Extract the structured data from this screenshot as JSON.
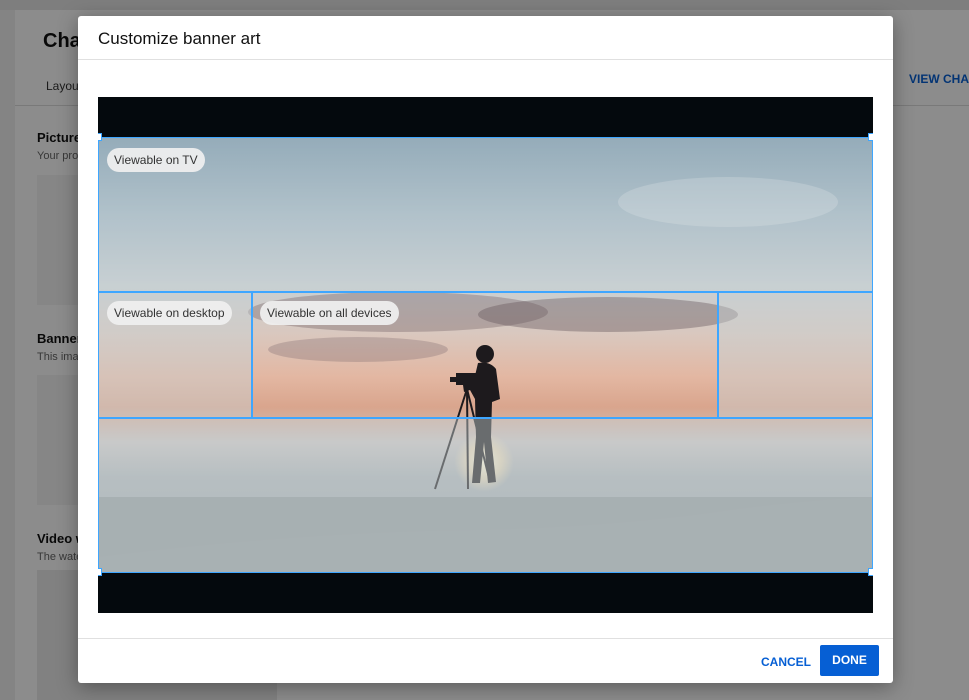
{
  "background": {
    "page_title": "Cha",
    "tab": "Layout",
    "view_channel": "VIEW CHAN",
    "sections": [
      {
        "title": "Picture",
        "desc": "Your pro"
      },
      {
        "title": "Banner",
        "desc": "This ima"
      },
      {
        "title": "Video w",
        "desc": "The wate"
      }
    ]
  },
  "dialog": {
    "title": "Customize banner art",
    "labels": {
      "tv": "Viewable on TV",
      "desktop": "Viewable on desktop",
      "all_devices": "Viewable on all devices"
    },
    "cancel_label": "CANCEL",
    "done_label": "DONE"
  },
  "colors": {
    "accent": "#3ea6ff",
    "primary_button": "#065fd4"
  }
}
